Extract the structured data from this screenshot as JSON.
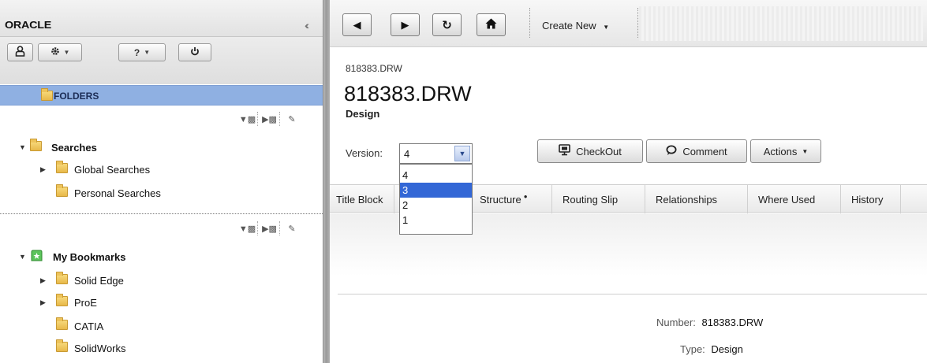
{
  "app": {
    "logo_text": "ORACLE"
  },
  "left_pane": {
    "utility_buttons": [
      {
        "icon": "user-icon"
      },
      {
        "icon": "gear-icon"
      },
      {
        "label": "?"
      },
      {
        "icon": "power-icon"
      }
    ],
    "folders_label": "FOLDERS",
    "searches": {
      "label": "Searches",
      "children": [
        "Global Searches",
        "Personal Searches"
      ]
    },
    "bookmarks": {
      "label": "My Bookmarks",
      "children": [
        "Solid Edge",
        "ProE",
        "CATIA",
        "SolidWorks"
      ]
    }
  },
  "toolbar": {
    "nav_buttons": [
      "back-icon",
      "forward-icon",
      "refresh-icon",
      "home-icon"
    ],
    "create_new_label": "Create New"
  },
  "object": {
    "breadcrumb": "818383.DRW",
    "title": "818383.DRW",
    "subtype": "Design",
    "version_label": "Version:",
    "version_value": "4",
    "version_options": [
      "4",
      "3",
      "2",
      "1"
    ],
    "version_highlighted": "3",
    "buttons": {
      "checkout": "CheckOut",
      "comment": "Comment",
      "actions": "Actions"
    }
  },
  "tabs": [
    "Title Block",
    "Structure",
    "Routing Slip",
    "Relationships",
    "Where Used",
    "History"
  ],
  "fields": {
    "number_label": "Number:",
    "number_value": "818383.DRW",
    "type_label": "Type:",
    "type_value": "Design"
  },
  "colors": {
    "selected_row": "#8fb0e2",
    "highlight_option": "#3367d6"
  }
}
